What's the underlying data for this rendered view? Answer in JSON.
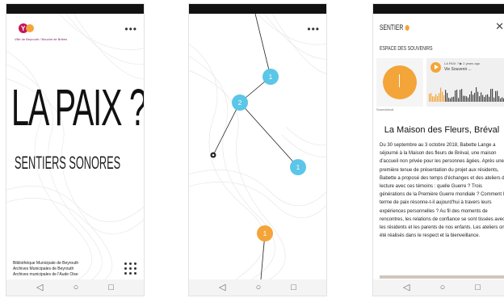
{
  "nav": {
    "back": "◁",
    "home": "○",
    "recent": "□"
  },
  "menu_dots": "•••",
  "colors": {
    "orange": "#f4a53a",
    "blue": "#5bc6e8",
    "accent": "#c2185b"
  },
  "screen1": {
    "logo_caption": "Ville de Beyrouth / Bouche de Bribes",
    "title": "LA PAIX ?",
    "subtitle": "SENTIERS SONORES",
    "credits": [
      "Bibliothèque Municipale de Beyrouth",
      "Archives Municipales de Beyrouth",
      "Archives municipales de l'Aude Oise"
    ]
  },
  "screen2": {
    "nodes": [
      {
        "label": "1",
        "color": "blue"
      },
      {
        "label": "2",
        "color": "blue"
      },
      {
        "label": "1",
        "color": "blue"
      },
      {
        "label": "1",
        "color": "orange"
      },
      {
        "label": "",
        "color": "dark"
      }
    ]
  },
  "screen3": {
    "header": "SENTIER",
    "close": "✕",
    "section_label": "ESPACE DES SOUVENIRS",
    "thumb_caption": "Soundcloud",
    "player_meta": "LA PAIX ?  ▶ 2 years ago",
    "player_title": "Vie Souvenir ...",
    "place_title": "La Maison des Fleurs, Bréval",
    "body": "Du 30 septembre au 3 octobre 2018, Babette Lange a séjourné à la Maison des fleurs de Bréval, une maison d'accueil non privée pour les personnes âgées. Après une première tenue de présentation du projet aux résidents, Babette a proposé des temps d'échanges et des ateliers de lecture avec ces témoins : quelle Guerre ? Trois générations de la Première Guerre mondiale ? Comment le terme de paix résonne-t-il aujourd'hui à travers leurs expériences personnelles ? Au fil des moments de rencontres, les relations de confiance se sont tissées avec les résidents et les parents de nos enfants. Les ateliers ont été réalisés dans le respect et la bienveillance."
  }
}
